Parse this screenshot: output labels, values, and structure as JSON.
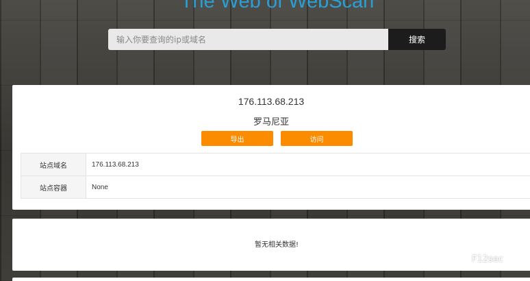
{
  "header": {
    "site_title": "The Web of WebScan"
  },
  "search": {
    "placeholder": "输入你要查询的ip或域名",
    "value": "",
    "button_label": "搜索"
  },
  "result": {
    "ip": "176.113.68.213",
    "country": "罗马尼亚",
    "export_label": "导出",
    "visit_label": "访问",
    "rows": [
      {
        "label": "站点域名",
        "value": "176.113.68.213"
      },
      {
        "label": "站点容器",
        "value": "None"
      }
    ]
  },
  "secondary": {
    "empty_message": "暂无相关数据!"
  },
  "watermark": {
    "text": "F12sec",
    "icon": "wechat-icon"
  },
  "colors": {
    "title": "#2a9fd6",
    "accent_button": "#fb8c00",
    "search_button": "#1c1c1c"
  }
}
